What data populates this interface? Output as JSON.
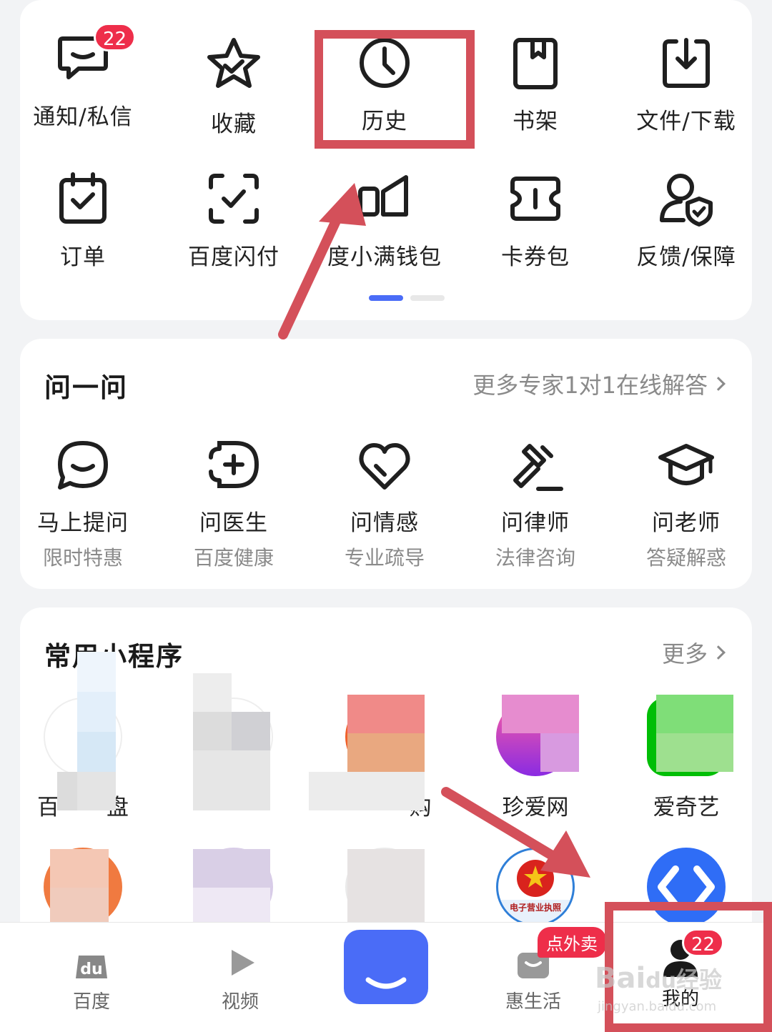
{
  "tools": {
    "items": [
      {
        "label": "通知/私信",
        "icon": "message-icon",
        "badge": "22"
      },
      {
        "label": "收藏",
        "icon": "star-icon"
      },
      {
        "label": "历史",
        "icon": "clock-icon"
      },
      {
        "label": "书架",
        "icon": "bookmark-icon"
      },
      {
        "label": "文件/下载",
        "icon": "download-icon"
      },
      {
        "label": "订单",
        "icon": "calendar-check-icon"
      },
      {
        "label": "百度闪付",
        "icon": "scan-check-icon"
      },
      {
        "label": "度小满钱包",
        "icon": "wallet-icon"
      },
      {
        "label": "卡券包",
        "icon": "ticket-icon"
      },
      {
        "label": "反馈/保障",
        "icon": "user-shield-icon"
      }
    ],
    "page_indicator": {
      "pages": 2,
      "active": 1
    }
  },
  "ask": {
    "title": "问一问",
    "more": "更多专家1对1在线解答",
    "items": [
      {
        "label": "马上提问",
        "sub": "限时特惠",
        "icon": "chat-smile-icon"
      },
      {
        "label": "问医生",
        "sub": "百度健康",
        "icon": "medical-plus-icon"
      },
      {
        "label": "问情感",
        "sub": "专业疏导",
        "icon": "heart-icon"
      },
      {
        "label": "问律师",
        "sub": "法律咨询",
        "icon": "gavel-icon"
      },
      {
        "label": "问老师",
        "sub": "答疑解惑",
        "icon": "graduation-cap-icon"
      }
    ]
  },
  "mini": {
    "title": "常用小程序",
    "more": "更多",
    "row1": [
      {
        "label": "百",
        "label_suffix": "盘"
      },
      {
        "label": "",
        "label_suffix": "+"
      },
      {
        "label": "",
        "label_suffix": "购"
      },
      {
        "label": "珍爱网"
      },
      {
        "label": "爱奇艺"
      }
    ],
    "row2_emblem_text": "电子营业执照"
  },
  "tabbar": {
    "items": [
      {
        "label": "百度",
        "icon": "du-logo-icon"
      },
      {
        "label": "视频",
        "icon": "play-icon"
      },
      {
        "label": "",
        "icon": "center-home-icon"
      },
      {
        "label": "惠生活",
        "icon": "shopping-bag-icon",
        "tag": "点外卖"
      },
      {
        "label": "我的",
        "icon": "user-icon",
        "badge": "22"
      }
    ]
  },
  "watermark": {
    "brand": "Bai",
    "paw": "du",
    "cn": "经验",
    "url": "jingyan.baidu.com"
  },
  "colors": {
    "annotation": "#d4505a",
    "badge": "#ee2e4a",
    "accent_blue": "#4a6cf7"
  }
}
